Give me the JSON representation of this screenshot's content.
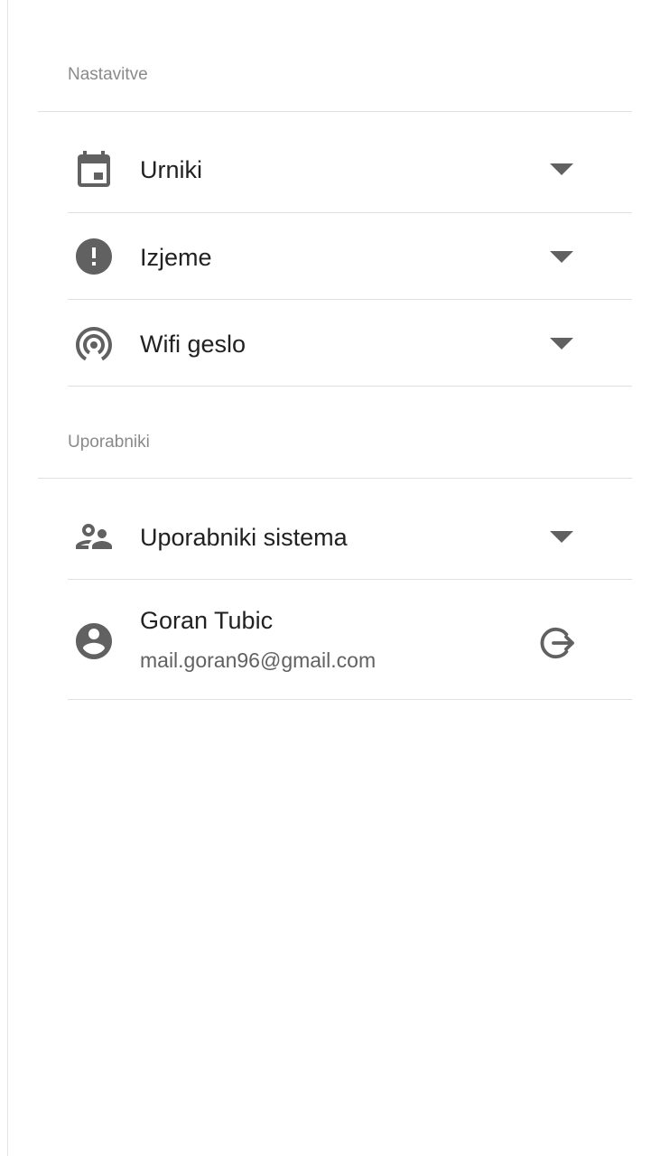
{
  "sections": {
    "settings_title": "Nastavitve",
    "users_title": "Uporabniki"
  },
  "settings_items": [
    {
      "label": "Urniki",
      "icon": "calendar-icon"
    },
    {
      "label": "Izjeme",
      "icon": "exclamation-circle-icon"
    },
    {
      "label": "Wifi geslo",
      "icon": "wifi-tethering-icon"
    }
  ],
  "users_item": {
    "label": "Uporabniki sistema",
    "icon": "supervisor-account-icon"
  },
  "account": {
    "name": "Goran Tubic",
    "email": "mail.goran96@gmail.com",
    "avatar_icon": "account-circle-icon",
    "logout_icon": "logout-icon"
  },
  "colors": {
    "icon": "#616161",
    "text": "#212121",
    "subheader": "#8a8a8a",
    "divider": "#e0e0e0"
  }
}
